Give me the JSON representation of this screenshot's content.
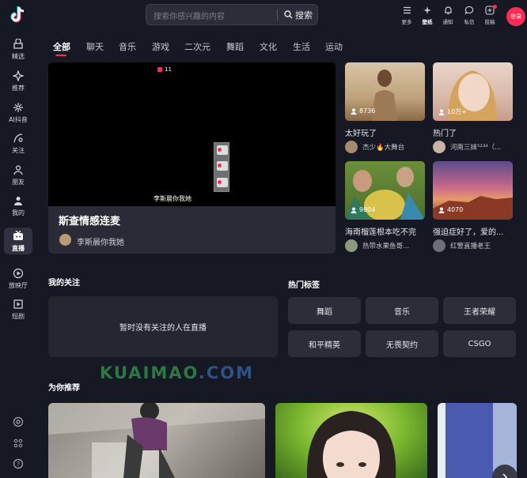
{
  "sidebar": {
    "items": [
      {
        "label": "精选",
        "icon": "featured-icon"
      },
      {
        "label": "推荐",
        "icon": "sparkle-icon"
      },
      {
        "label": "AI抖音",
        "icon": "ai-icon"
      },
      {
        "label": "关注",
        "icon": "follow-icon"
      },
      {
        "label": "朋友",
        "icon": "friends-icon"
      },
      {
        "label": "我的",
        "icon": "profile-icon"
      },
      {
        "label": "直播",
        "icon": "live-tv-icon"
      },
      {
        "label": "放映厅",
        "icon": "cinema-icon"
      },
      {
        "label": "短剧",
        "icon": "short-drama-icon"
      }
    ],
    "active": "直播"
  },
  "header": {
    "search_placeholder": "搜索你感兴趣的内容",
    "search_button": "搜索",
    "icons": [
      {
        "label": "更多",
        "icon": "menu-icon"
      },
      {
        "label": "壁纸",
        "icon": "wallpaper-icon"
      },
      {
        "label": "通知",
        "icon": "bell-icon"
      },
      {
        "label": "私信",
        "icon": "message-icon"
      },
      {
        "label": "投稿",
        "icon": "upload-icon"
      }
    ],
    "login": "登录"
  },
  "tabs": [
    "全部",
    "聊天",
    "音乐",
    "游戏",
    "二次元",
    "舞蹈",
    "文化",
    "生活",
    "运动"
  ],
  "main_stream": {
    "viewers": "11",
    "caption": "李斯晨你我她",
    "title": "斯查情感连麦",
    "author": "李斯晨你我她"
  },
  "cards": [
    {
      "count": "8736",
      "title": "太好玩了",
      "author": "杰少🔥大舞台"
    },
    {
      "count": "10万+",
      "title": "热门了",
      "author": "河南三妹⁵²³³（..."
    },
    {
      "count": "9804",
      "title": "海南榴莲根本吃不完",
      "author": "热带水果鱼哥..."
    },
    {
      "count": "4070",
      "title": "强迫症好了，爱的...",
      "author": "红警直播老王"
    }
  ],
  "following": {
    "title": "我的关注",
    "empty": "暂时没有关注的人在直播"
  },
  "hot_tags": {
    "title": "热门标签",
    "items": [
      "舞蹈",
      "音乐",
      "王者荣耀",
      "和平精英",
      "无畏契约",
      "CSGO"
    ]
  },
  "watermark": {
    "part1": "KUAIMAO",
    "part2": ".COM"
  },
  "recommend": {
    "title": "为你推荐"
  },
  "colors": {
    "accent": "#fe2c55",
    "background": "#161823",
    "card": "#252632"
  }
}
